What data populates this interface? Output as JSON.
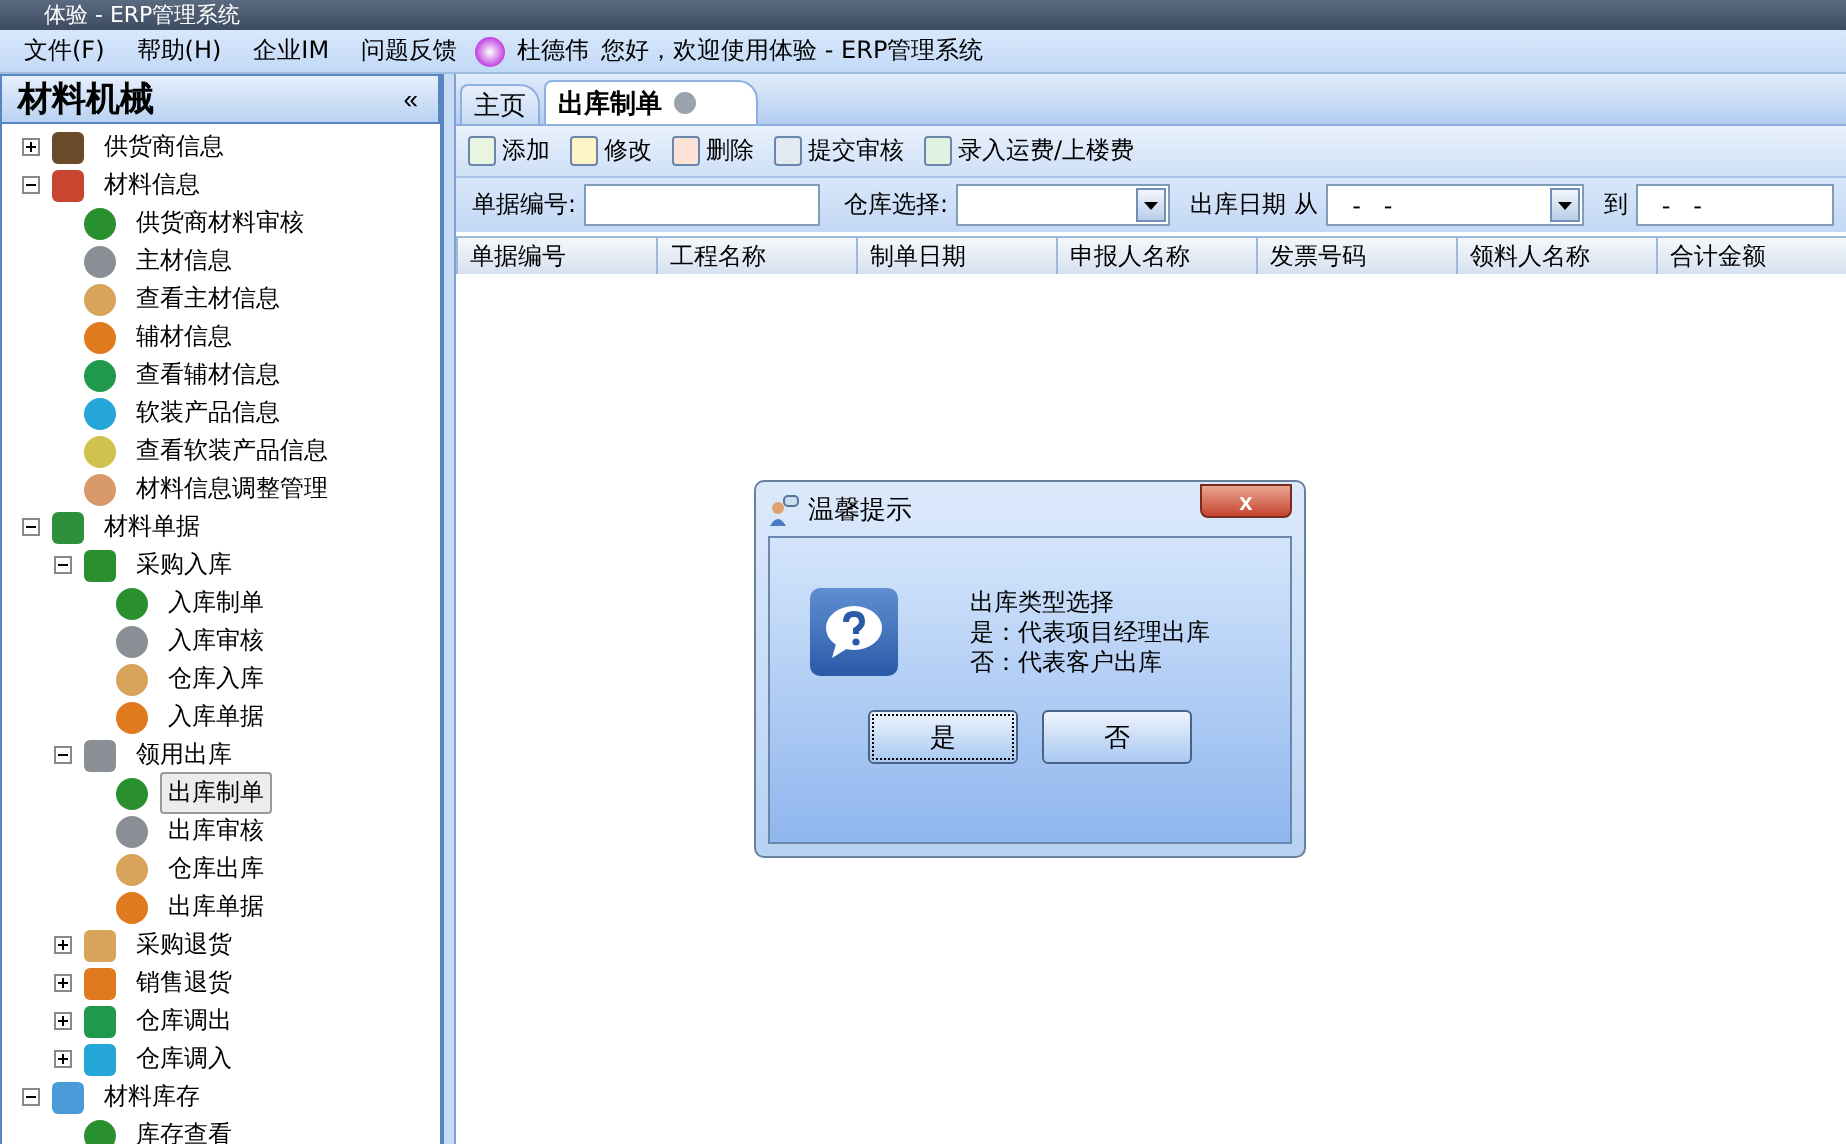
{
  "window": {
    "title": "体验 - ERP管理系统"
  },
  "menu": [
    {
      "label": "文件(F)"
    },
    {
      "label": "帮助(H)"
    },
    {
      "label": "企业IM"
    },
    {
      "label": "问题反馈"
    }
  ],
  "greeting": {
    "user": "杜德伟",
    "text": "您好，欢迎使用体验 - ERP管理系统"
  },
  "sidebar": {
    "title": "材料机械",
    "collapse": "«",
    "items": [
      {
        "label": "供货商信息",
        "expanded": false,
        "selected": false
      },
      {
        "label": "材料信息",
        "expanded": true,
        "selected": false,
        "children": [
          {
            "label": "供货商材料审核",
            "selected": false
          },
          {
            "label": "主材信息",
            "selected": false
          },
          {
            "label": "查看主材信息",
            "selected": false
          },
          {
            "label": "辅材信息",
            "selected": false
          },
          {
            "label": "查看辅材信息",
            "selected": false
          },
          {
            "label": "软装产品信息",
            "selected": false
          },
          {
            "label": "查看软装产品信息",
            "selected": false
          },
          {
            "label": "材料信息调整管理",
            "selected": false
          }
        ]
      },
      {
        "label": "材料单据",
        "expanded": true,
        "selected": false,
        "children": [
          {
            "label": "采购入库",
            "expanded": true,
            "selected": false,
            "children": [
              {
                "label": "入库制单",
                "selected": false
              },
              {
                "label": "入库审核",
                "selected": false
              },
              {
                "label": "仓库入库",
                "selected": false
              },
              {
                "label": "入库单据",
                "selected": false
              }
            ]
          },
          {
            "label": "领用出库",
            "expanded": true,
            "selected": false,
            "children": [
              {
                "label": "出库制单",
                "selected": true
              },
              {
                "label": "出库审核",
                "selected": false
              },
              {
                "label": "仓库出库",
                "selected": false
              },
              {
                "label": "出库单据",
                "selected": false
              }
            ]
          },
          {
            "label": "采购退货",
            "expanded": false,
            "selected": false
          },
          {
            "label": "销售退货",
            "expanded": false,
            "selected": false
          },
          {
            "label": "仓库调出",
            "expanded": false,
            "selected": false
          },
          {
            "label": "仓库调入",
            "expanded": false,
            "selected": false
          }
        ]
      },
      {
        "label": "材料库存",
        "expanded": true,
        "selected": false,
        "children": [
          {
            "label": "库存查看",
            "selected": false
          }
        ]
      }
    ]
  },
  "tabs": [
    {
      "label": "主页",
      "selected": false,
      "closable": false
    },
    {
      "label": "出库制单",
      "selected": true,
      "closable": true
    }
  ],
  "toolbar": [
    {
      "label": "添加"
    },
    {
      "label": "修改"
    },
    {
      "label": "删除"
    },
    {
      "label": "提交审核"
    },
    {
      "label": "录入运费/上楼费"
    }
  ],
  "filters": {
    "number_label": "单据编号:",
    "warehouse_label": "仓库选择:",
    "date_label": "出库日期",
    "from_label": "从",
    "date_from": "-   -",
    "to_label": "到",
    "date_to": "-   -"
  },
  "table": {
    "columns": [
      "单据编号",
      "工程名称",
      "制单日期",
      "申报人名称",
      "发票号码",
      "领料人名称",
      "合计金额"
    ]
  },
  "dialog": {
    "title": "温馨提示",
    "lines": [
      "出库类型选择",
      "是：代表项目经理出库",
      "否：代表客户出库"
    ],
    "close": "x",
    "buttons": [
      {
        "label": "是",
        "focused": true
      },
      {
        "label": "否",
        "focused": false
      }
    ]
  }
}
